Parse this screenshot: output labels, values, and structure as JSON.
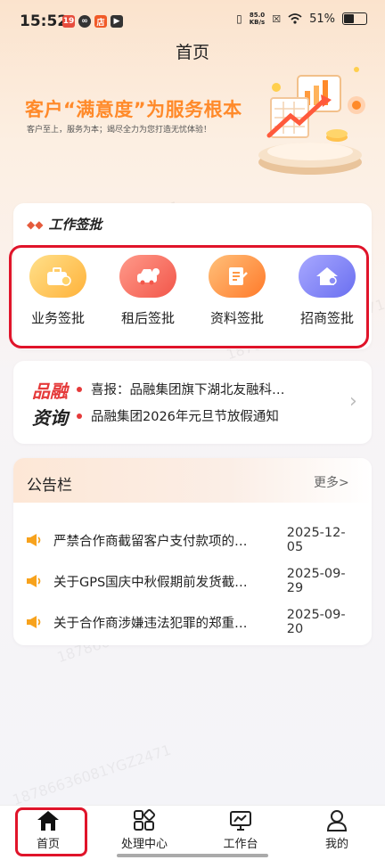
{
  "status_bar": {
    "time": "15:52",
    "net_speed_value": "85.0",
    "net_speed_unit": "KB/s",
    "battery": "51%"
  },
  "header": {
    "title": "首页"
  },
  "banner": {
    "title": "客户“满意度”为服务根本",
    "subtitle": "客户至上，服务为本；竭尽全力为您打造无忧体验！"
  },
  "work_section": {
    "title": "工作签批",
    "items": [
      {
        "label": "业务签批",
        "icon": "briefcase-icon"
      },
      {
        "label": "租后签批",
        "icon": "car-icon"
      },
      {
        "label": "资料签批",
        "icon": "document-icon"
      },
      {
        "label": "招商签批",
        "icon": "house-icon"
      }
    ]
  },
  "news": {
    "logo_line1": "品融",
    "logo_line2": "资询",
    "items": [
      "喜报：品融集团旗下湖北友融科…",
      "品融集团2026年元旦节放假通知"
    ]
  },
  "notice_board": {
    "title": "公告栏",
    "more": "更多>",
    "items": [
      {
        "text": "严禁合作商截留客户支付款项的…",
        "date": "2025-12-05"
      },
      {
        "text": "关于GPS国庆中秋假期前发货截…",
        "date": "2025-09-29"
      },
      {
        "text": "关于合作商涉嫌违法犯罪的郑重…",
        "date": "2025-09-20"
      }
    ]
  },
  "watermark": "18786636081YGZ2471",
  "bottom_nav": [
    {
      "label": "首页",
      "icon": "home-icon",
      "active": true
    },
    {
      "label": "处理中心",
      "icon": "grid-icon",
      "active": false
    },
    {
      "label": "工作台",
      "icon": "monitor-icon",
      "active": false
    },
    {
      "label": "我的",
      "icon": "user-icon",
      "active": false
    }
  ],
  "colors": {
    "accent_orange": "#ff8a2a",
    "highlight_red": "#e0142a",
    "news_red": "#e53a3a"
  }
}
